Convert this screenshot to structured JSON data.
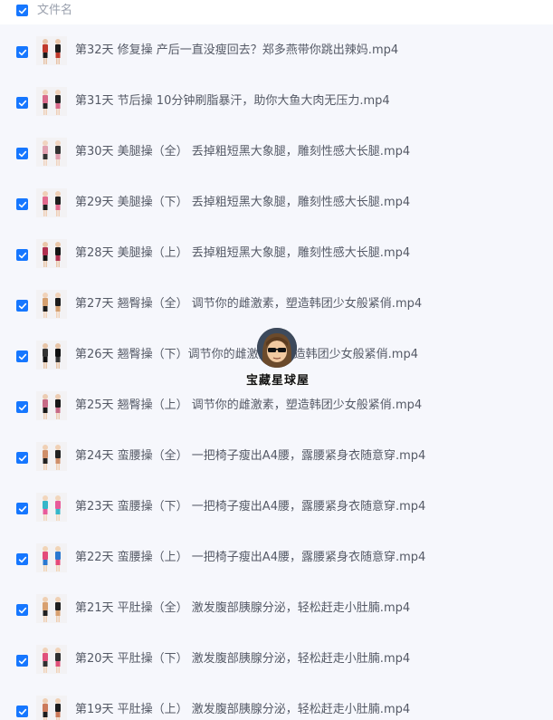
{
  "header": {
    "column_label": "文件名",
    "select_all_checked": true
  },
  "accent_color": "#1677ff",
  "files": [
    {
      "name": "第32天 修复操 产后一直没瘦回去？郑多燕带你跳出辣妈.mp4",
      "checked": true,
      "thumb_icon": "video-thumbnail-icon"
    },
    {
      "name": "第31天 节后操 10分钟刷脂暴汗，助你大鱼大肉无压力.mp4",
      "checked": true,
      "thumb_icon": "video-thumbnail-icon"
    },
    {
      "name": "第30天 美腿操（全） 丢掉粗短黑大象腿，雕刻性感大长腿.mp4",
      "checked": true,
      "thumb_icon": "video-thumbnail-icon"
    },
    {
      "name": "第29天 美腿操（下） 丢掉粗短黑大象腿，雕刻性感大长腿.mp4",
      "checked": true,
      "thumb_icon": "video-thumbnail-icon"
    },
    {
      "name": "第28天 美腿操（上） 丢掉粗短黑大象腿，雕刻性感大长腿.mp4",
      "checked": true,
      "thumb_icon": "video-thumbnail-icon"
    },
    {
      "name": "第27天 翘臀操（全） 调节你的雌激素，塑造韩团少女般紧俏.mp4",
      "checked": true,
      "thumb_icon": "video-thumbnail-icon"
    },
    {
      "name": "第26天 翘臀操（下）调节你的雌激素，塑造韩团少女般紧俏.mp4",
      "checked": true,
      "thumb_icon": "video-thumbnail-icon"
    },
    {
      "name": "第25天 翘臀操（上） 调节你的雌激素，塑造韩团少女般紧俏.mp4",
      "checked": true,
      "thumb_icon": "video-thumbnail-icon"
    },
    {
      "name": "第24天 蛮腰操（全） 一把椅子瘦出A4腰，露腰紧身衣随意穿.mp4",
      "checked": true,
      "thumb_icon": "video-thumbnail-icon"
    },
    {
      "name": "第23天 蛮腰操（下） 一把椅子瘦出A4腰，露腰紧身衣随意穿.mp4",
      "checked": true,
      "thumb_icon": "video-thumbnail-icon"
    },
    {
      "name": "第22天 蛮腰操（上） 一把椅子瘦出A4腰，露腰紧身衣随意穿.mp4",
      "checked": true,
      "thumb_icon": "video-thumbnail-icon"
    },
    {
      "name": "第21天 平肚操（全） 激发腹部胰腺分泌，轻松赶走小肚腩.mp4",
      "checked": true,
      "thumb_icon": "video-thumbnail-icon"
    },
    {
      "name": "第20天 平肚操（下） 激发腹部胰腺分泌，轻松赶走小肚腩.mp4",
      "checked": true,
      "thumb_icon": "video-thumbnail-icon"
    },
    {
      "name": "第19天 平肚操（上） 激发腹部胰腺分泌，轻松赶走小肚腩.mp4",
      "checked": true,
      "thumb_icon": "video-thumbnail-icon"
    }
  ],
  "watermark": {
    "text": "宝藏星球屋",
    "icon": "cartoon-avatar-logo"
  }
}
